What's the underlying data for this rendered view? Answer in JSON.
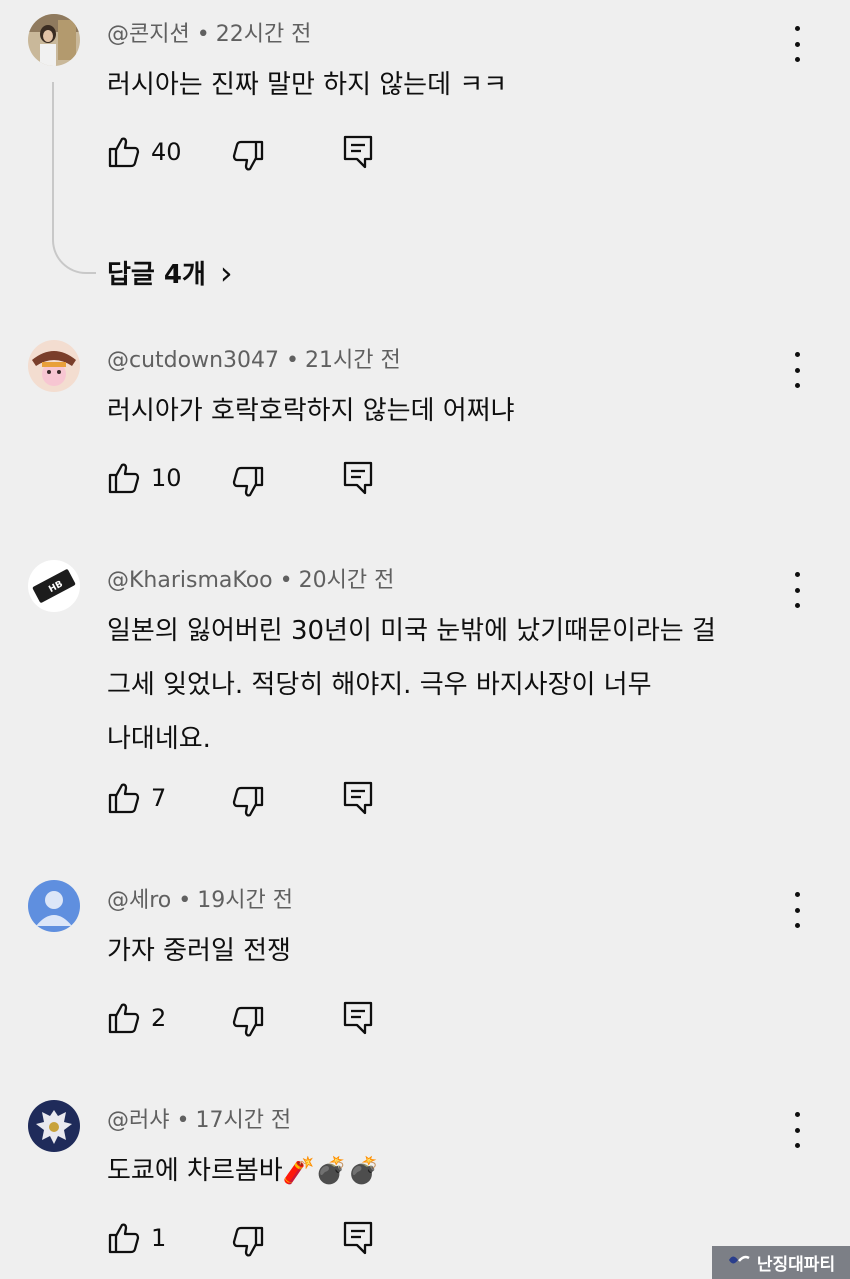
{
  "comments": [
    {
      "author": "@콘지션",
      "time": "22시간 전",
      "text": "러시아는 진짜 말만 하지 않는데 ㅋㅋ",
      "likes": "40"
    },
    {
      "author": "@cutdown3047",
      "time": "21시간 전",
      "text": "러시아가 호락호락하지 않는데 어쩌냐",
      "likes": "10"
    },
    {
      "author": "@KharismaKoo",
      "time": "20시간 전",
      "text_lines": [
        "일본의 잃어버린 30년이 미국 눈밖에 났기때문이라는 걸",
        "그세 잊었나. 적당히 해야지. 극우 바지사장이 너무",
        "나대네요."
      ],
      "likes": "7",
      "avatar_label": "HB"
    },
    {
      "author": "@세ro",
      "time": "19시간 전",
      "text": "가자 중러일 전쟁",
      "likes": "2"
    },
    {
      "author": "@러샤",
      "time": "17시간 전",
      "text": "도쿄에 차르봄바🧨💣💣",
      "likes": "1"
    }
  ],
  "replies_link": "답글 4개",
  "replies_chevron": "›",
  "separator": "•",
  "icons": {
    "like": "thumbs-up-icon",
    "dislike": "thumbs-down-icon",
    "reply": "comment-reply-icon",
    "menu": "more-vertical-icon"
  },
  "watermark": {
    "text": "난징대파티"
  },
  "colors": {
    "background": "#efefef",
    "meta_text": "#606060",
    "primary_text": "#0f0f0f",
    "default_avatar": "#5f8fdf"
  }
}
